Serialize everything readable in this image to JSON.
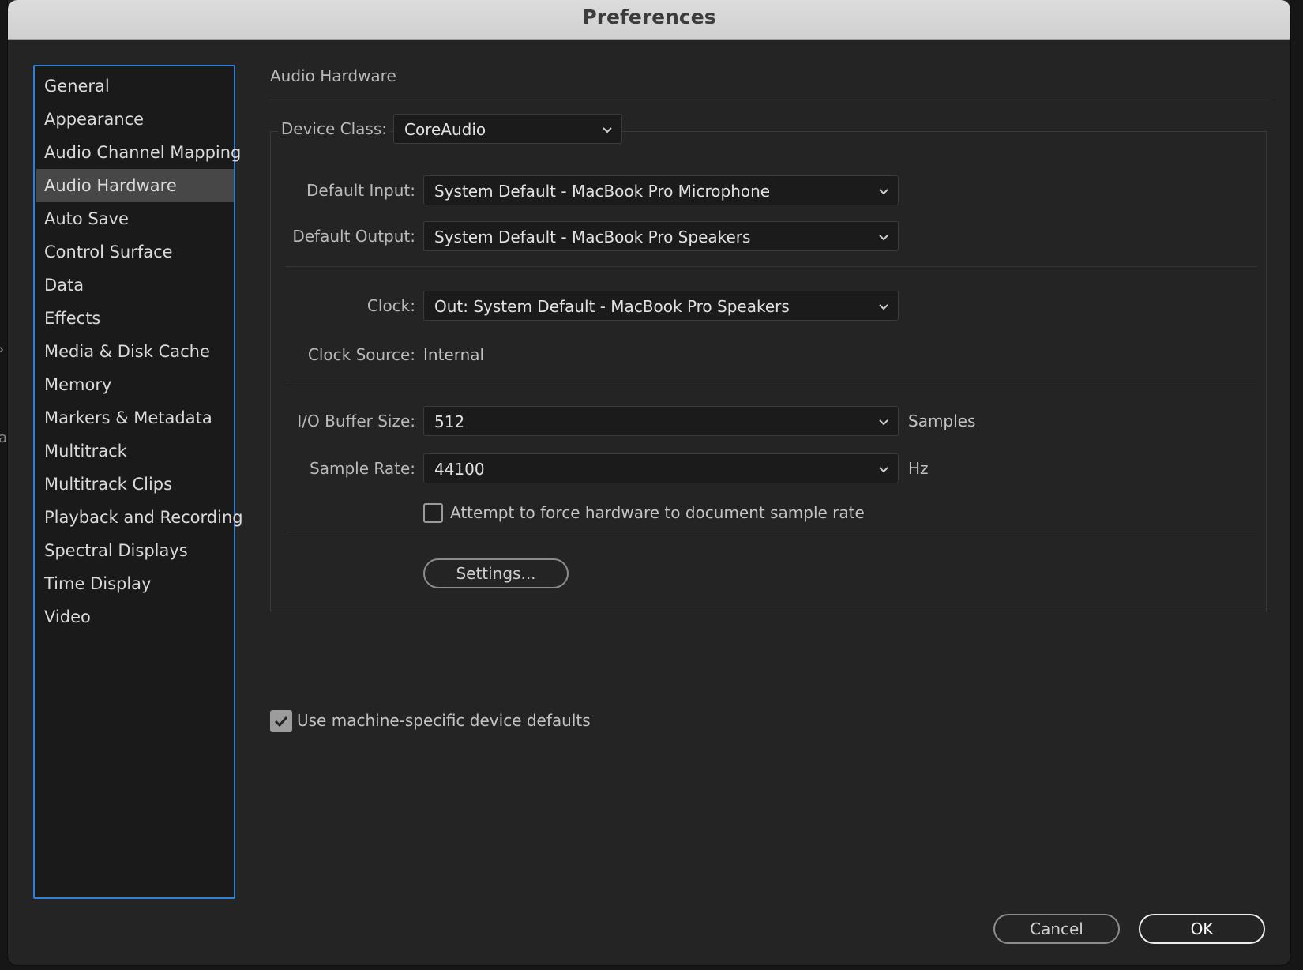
{
  "window": {
    "title": "Preferences"
  },
  "sidebar": {
    "items": [
      {
        "label": "General"
      },
      {
        "label": "Appearance"
      },
      {
        "label": "Audio Channel Mapping"
      },
      {
        "label": "Audio Hardware",
        "selected": true
      },
      {
        "label": "Auto Save"
      },
      {
        "label": "Control Surface"
      },
      {
        "label": "Data"
      },
      {
        "label": "Effects"
      },
      {
        "label": "Media & Disk Cache"
      },
      {
        "label": "Memory"
      },
      {
        "label": "Markers & Metadata"
      },
      {
        "label": "Multitrack"
      },
      {
        "label": "Multitrack Clips"
      },
      {
        "label": "Playback and Recording"
      },
      {
        "label": "Spectral Displays"
      },
      {
        "label": "Time Display"
      },
      {
        "label": "Video"
      }
    ]
  },
  "main": {
    "section_title": "Audio Hardware",
    "device_class": {
      "label": "Device Class:",
      "value": "CoreAudio"
    },
    "default_input": {
      "label": "Default Input:",
      "value": "System Default - MacBook Pro Microphone"
    },
    "default_output": {
      "label": "Default Output:",
      "value": "System Default - MacBook Pro Speakers"
    },
    "clock": {
      "label": "Clock:",
      "value": "Out: System Default - MacBook Pro Speakers"
    },
    "clock_source": {
      "label": "Clock Source:",
      "value": "Internal"
    },
    "buffer_size": {
      "label": "I/O Buffer Size:",
      "value": "512",
      "unit": "Samples"
    },
    "sample_rate": {
      "label": "Sample Rate:",
      "value": "44100",
      "unit": "Hz"
    },
    "force_rate": {
      "label": "Attempt to force hardware to document sample rate",
      "checked": false
    },
    "settings_button": "Settings...",
    "machine_defaults": {
      "label": "Use machine-specific device defaults",
      "checked": true
    }
  },
  "footer": {
    "cancel_label": "Cancel",
    "ok_label": "OK"
  },
  "colors": {
    "accent": "#2f7fd7",
    "dialog_bg": "#242424",
    "selected_item": "#474747"
  },
  "icons": {
    "dropdown": "chevron-down-icon",
    "check": "checkmark-icon"
  }
}
